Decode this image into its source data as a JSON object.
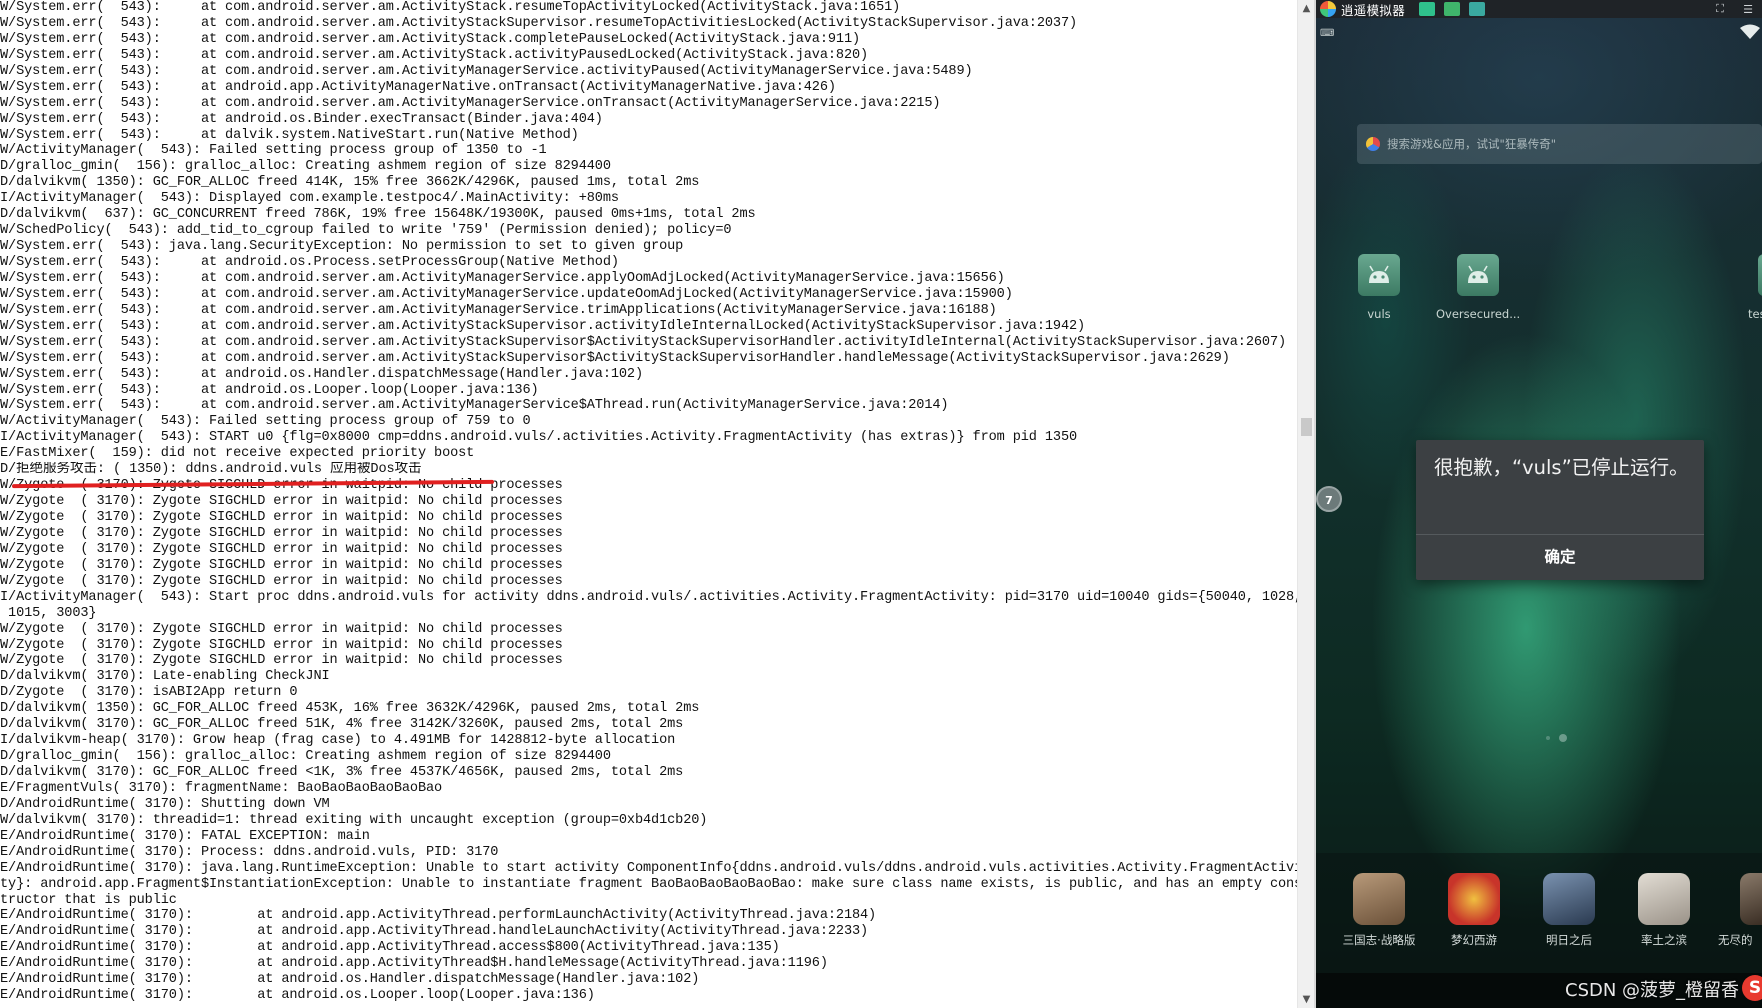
{
  "console": {
    "lines": [
      "W/System.err(  543):     at com.android.server.am.ActivityStack.resumeTopActivityLocked(ActivityStack.java:1651)",
      "W/System.err(  543):     at com.android.server.am.ActivityStackSupervisor.resumeTopActivitiesLocked(ActivityStackSupervisor.java:2037)",
      "W/System.err(  543):     at com.android.server.am.ActivityStack.completePauseLocked(ActivityStack.java:911)",
      "W/System.err(  543):     at com.android.server.am.ActivityStack.activityPausedLocked(ActivityStack.java:820)",
      "W/System.err(  543):     at com.android.server.am.ActivityManagerService.activityPaused(ActivityManagerService.java:5489)",
      "W/System.err(  543):     at android.app.ActivityManagerNative.onTransact(ActivityManagerNative.java:426)",
      "W/System.err(  543):     at com.android.server.am.ActivityManagerService.onTransact(ActivityManagerService.java:2215)",
      "W/System.err(  543):     at android.os.Binder.execTransact(Binder.java:404)",
      "W/System.err(  543):     at dalvik.system.NativeStart.run(Native Method)",
      "W/ActivityManager(  543): Failed setting process group of 1350 to -1",
      "D/gralloc_gmin(  156): gralloc_alloc: Creating ashmem region of size 8294400",
      "D/dalvikvm( 1350): GC_FOR_ALLOC freed 414K, 15% free 3662K/4296K, paused 1ms, total 2ms",
      "I/ActivityManager(  543): Displayed com.example.testpoc4/.MainActivity: +80ms",
      "D/dalvikvm(  637): GC_CONCURRENT freed 786K, 19% free 15648K/19300K, paused 0ms+1ms, total 2ms",
      "W/SchedPolicy(  543): add_tid_to_cgroup failed to write '759' (Permission denied); policy=0",
      "W/System.err(  543): java.lang.SecurityException: No permission to set to given group",
      "W/System.err(  543):     at android.os.Process.setProcessGroup(Native Method)",
      "W/System.err(  543):     at com.android.server.am.ActivityManagerService.applyOomAdjLocked(ActivityManagerService.java:15656)",
      "W/System.err(  543):     at com.android.server.am.ActivityManagerService.updateOomAdjLocked(ActivityManagerService.java:15900)",
      "W/System.err(  543):     at com.android.server.am.ActivityManagerService.trimApplications(ActivityManagerService.java:16188)",
      "W/System.err(  543):     at com.android.server.am.ActivityStackSupervisor.activityIdleInternalLocked(ActivityStackSupervisor.java:1942)",
      "W/System.err(  543):     at com.android.server.am.ActivityStackSupervisor$ActivityStackSupervisorHandler.activityIdleInternal(ActivityStackSupervisor.java:2607)",
      "W/System.err(  543):     at com.android.server.am.ActivityStackSupervisor$ActivityStackSupervisorHandler.handleMessage(ActivityStackSupervisor.java:2629)",
      "W/System.err(  543):     at android.os.Handler.dispatchMessage(Handler.java:102)",
      "W/System.err(  543):     at android.os.Looper.loop(Looper.java:136)",
      "W/System.err(  543):     at com.android.server.am.ActivityManagerService$AThread.run(ActivityManagerService.java:2014)",
      "W/ActivityManager(  543): Failed setting process group of 759 to 0",
      "I/ActivityManager(  543): START u0 {flg=0x8000 cmp=ddns.android.vuls/.activities.Activity.FragmentActivity (has extras)} from pid 1350",
      "E/FastMixer(  159): did not receive expected priority boost",
      "D/拒绝服务攻击: ( 1350): ddns.android.vuls 应用被Dos攻击",
      "W/Zygote  ( 3170): Zygote SIGCHLD error in waitpid: No child processes",
      "W/Zygote  ( 3170): Zygote SIGCHLD error in waitpid: No child processes",
      "W/Zygote  ( 3170): Zygote SIGCHLD error in waitpid: No child processes",
      "W/Zygote  ( 3170): Zygote SIGCHLD error in waitpid: No child processes",
      "W/Zygote  ( 3170): Zygote SIGCHLD error in waitpid: No child processes",
      "W/Zygote  ( 3170): Zygote SIGCHLD error in waitpid: No child processes",
      "W/Zygote  ( 3170): Zygote SIGCHLD error in waitpid: No child processes",
      "I/ActivityManager(  543): Start proc ddns.android.vuls for activity ddns.android.vuls/.activities.Activity.FragmentActivity: pid=3170 uid=10040 gids={50040, 1028,",
      " 1015, 3003}",
      "W/Zygote  ( 3170): Zygote SIGCHLD error in waitpid: No child processes",
      "W/Zygote  ( 3170): Zygote SIGCHLD error in waitpid: No child processes",
      "W/Zygote  ( 3170): Zygote SIGCHLD error in waitpid: No child processes",
      "D/dalvikvm( 3170): Late-enabling CheckJNI",
      "D/Zygote  ( 3170): isABI2App return 0",
      "D/dalvikvm( 1350): GC_FOR_ALLOC freed 453K, 16% free 3632K/4296K, paused 2ms, total 2ms",
      "D/dalvikvm( 3170): GC_FOR_ALLOC freed 51K, 4% free 3142K/3260K, paused 2ms, total 2ms",
      "I/dalvikvm-heap( 3170): Grow heap (frag case) to 4.491MB for 1428812-byte allocation",
      "D/gralloc_gmin(  156): gralloc_alloc: Creating ashmem region of size 8294400",
      "D/dalvikvm( 3170): GC_FOR_ALLOC freed <1K, 3% free 4537K/4656K, paused 2ms, total 2ms",
      "E/FragmentVuls( 3170): fragmentName: BaoBaoBaoBaoBaoBao",
      "D/AndroidRuntime( 3170): Shutting down VM",
      "W/dalvikvm( 3170): threadid=1: thread exiting with uncaught exception (group=0xb4d1cb20)",
      "E/AndroidRuntime( 3170): FATAL EXCEPTION: main",
      "E/AndroidRuntime( 3170): Process: ddns.android.vuls, PID: 3170",
      "E/AndroidRuntime( 3170): java.lang.RuntimeException: Unable to start activity ComponentInfo{ddns.android.vuls/ddns.android.vuls.activities.Activity.FragmentActivi",
      "ty}: android.app.Fragment$InstantiationException: Unable to instantiate fragment BaoBaoBaoBaoBaoBao: make sure class name exists, is public, and has an empty cons",
      "tructor that is public",
      "E/AndroidRuntime( 3170):        at android.app.ActivityThread.performLaunchActivity(ActivityThread.java:2184)",
      "E/AndroidRuntime( 3170):        at android.app.ActivityThread.handleLaunchActivity(ActivityThread.java:2233)",
      "E/AndroidRuntime( 3170):        at android.app.ActivityThread.access$800(ActivityThread.java:135)",
      "E/AndroidRuntime( 3170):        at android.app.ActivityThread$H.handleMessage(ActivityThread.java:1196)",
      "E/AndroidRuntime( 3170):        at android.os.Handler.dispatchMessage(Handler.java:102)",
      "E/AndroidRuntime( 3170):        at android.os.Looper.loop(Looper.java:136)"
    ],
    "highlighted_line_index": 29,
    "underline_color": "#e02020",
    "scroll_up_icon": "▲",
    "scroll_down_icon": "▼"
  },
  "emulator": {
    "title": "逍遥模拟器",
    "search_placeholder": "搜索游戏&应用，试试\"狂暴传奇\"",
    "apps": [
      {
        "label": "vuls",
        "icon": "android-icon"
      },
      {
        "label": "Oversecured...",
        "icon": "android-icon"
      },
      {
        "label": "tes",
        "icon": "android-icon"
      }
    ],
    "side_badge": "7",
    "dialog": {
      "message": "很抱歉，“vuls”已停止运行。",
      "ok_label": "确定"
    },
    "dock": [
      {
        "label": "三国志·战略版",
        "color": "#8a6b4a"
      },
      {
        "label": "梦幻西游",
        "color": "#c8342a"
      },
      {
        "label": "明日之后",
        "color": "#4a6a8a"
      },
      {
        "label": "率土之滨",
        "color": "#b8b2a8"
      },
      {
        "label": "无尽的",
        "color": "#6a5a4a"
      }
    ]
  },
  "watermark": "CSDN @菠萝_橙留香"
}
